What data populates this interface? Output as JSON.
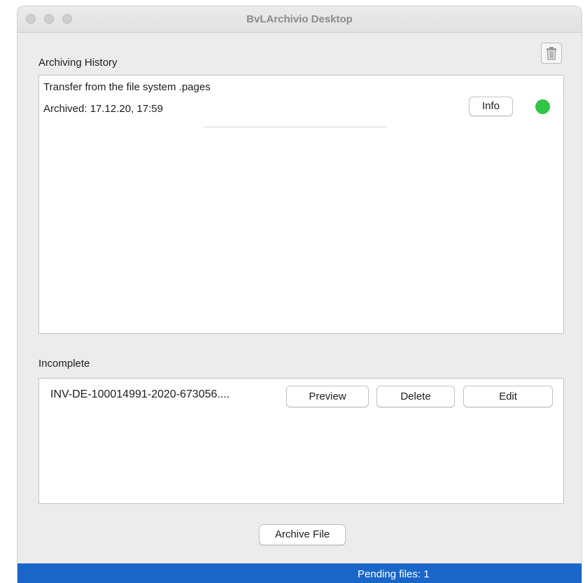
{
  "window": {
    "title": "BvLArchivio Desktop"
  },
  "toolbar": {
    "trash_icon": "trash-icon"
  },
  "history": {
    "label": "Archiving History",
    "entries": [
      {
        "name": "Transfer from the file system .pages",
        "archived": "Archived: 17.12.20, 17:59",
        "info_label": "Info",
        "status_color": "#2fc545"
      }
    ]
  },
  "incomplete": {
    "label": "Incomplete",
    "items": [
      {
        "name": "INV-DE-100014991-2020-673056....",
        "preview_label": "Preview",
        "delete_label": "Delete",
        "edit_label": "Edit"
      }
    ]
  },
  "actions": {
    "archive_label": "Archive File"
  },
  "statusbar": {
    "text": "Pending files:  1",
    "color": "#1a66c8"
  }
}
